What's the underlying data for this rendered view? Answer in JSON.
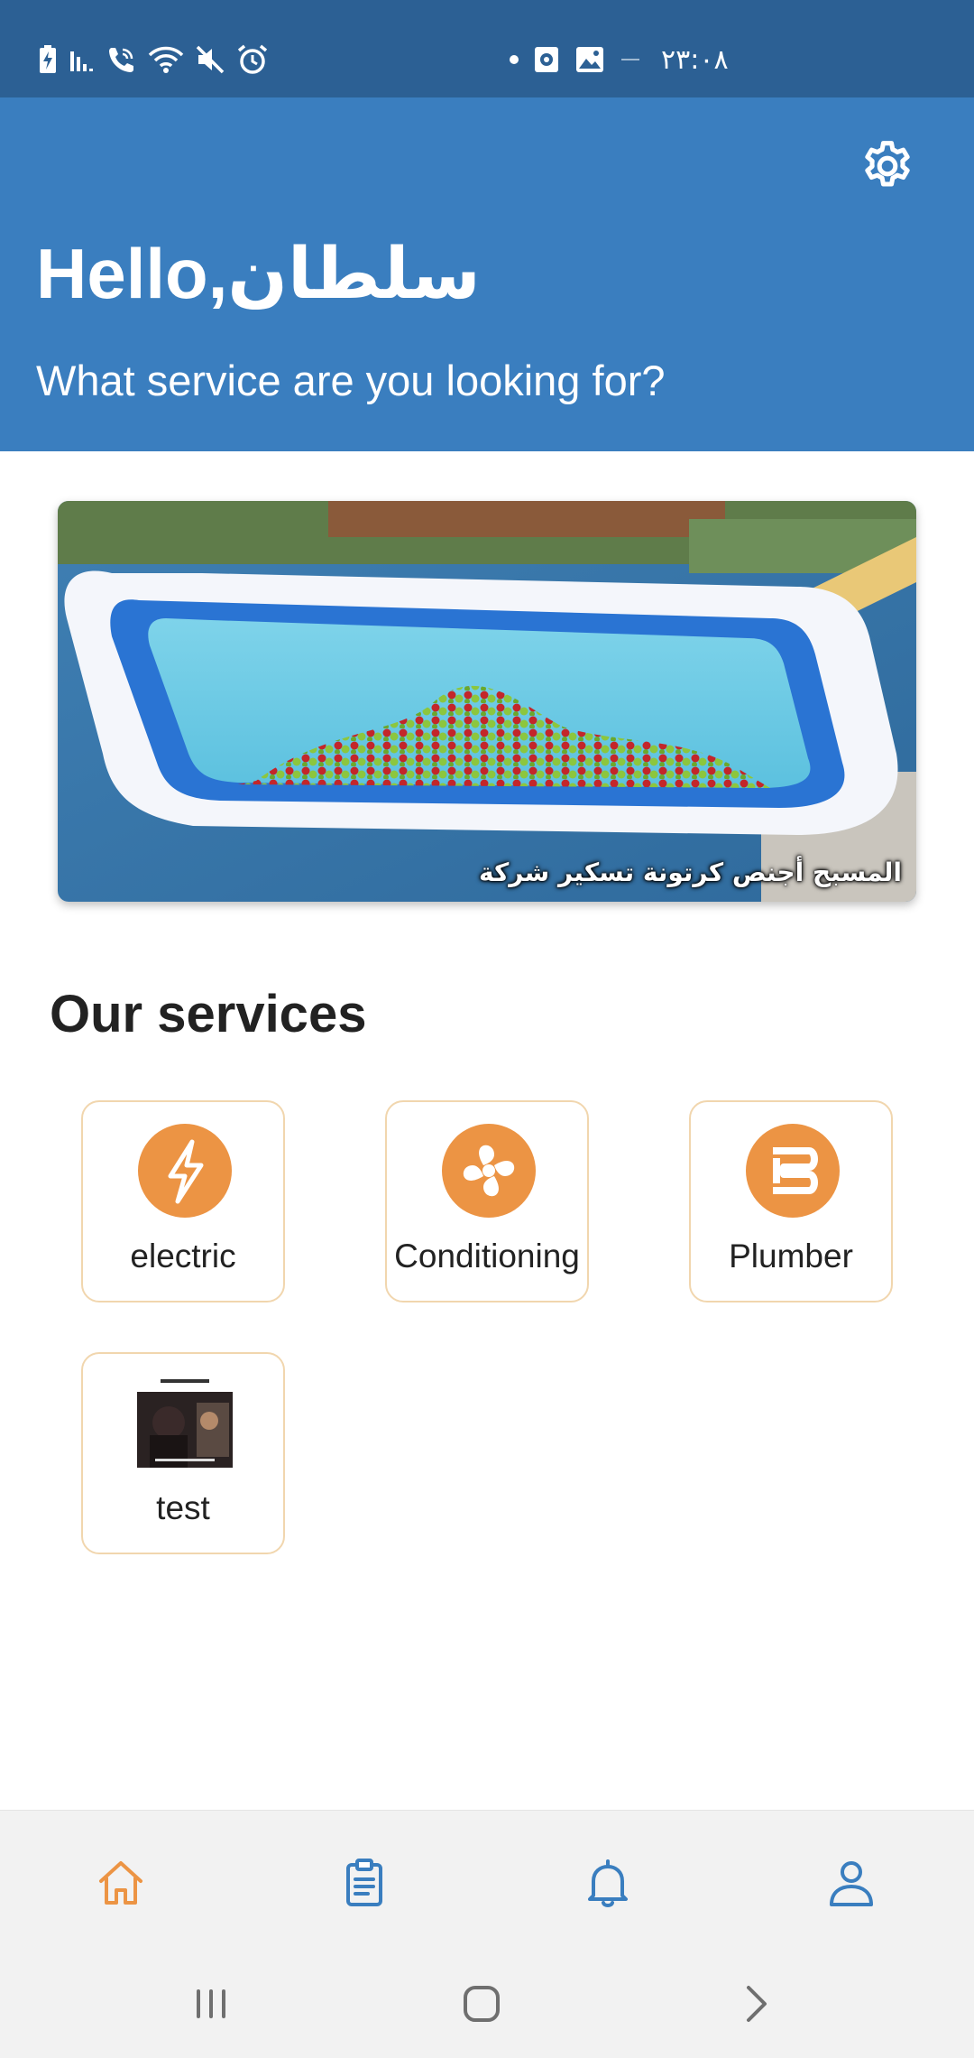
{
  "status_bar": {
    "time": "٢٣:٠٨",
    "icons": [
      "battery-charging-icon",
      "signal-icon",
      "wifi-call-icon",
      "wifi-icon",
      "mute-icon",
      "alarm-icon",
      "dot-icon",
      "screen-record-icon",
      "gallery-icon",
      "minus-icon"
    ]
  },
  "header": {
    "greeting_prefix": "Hello,",
    "user_name": "سلطان",
    "subtitle": "What service are you looking for?",
    "settings_icon": "gear-icon"
  },
  "banner": {
    "caption": "المسبح أجنص كرتونة تسكير شركة"
  },
  "services": {
    "title": "Our services",
    "items": [
      {
        "label": "electric",
        "icon": "lightning-icon"
      },
      {
        "label": "Conditioning",
        "icon": "fan-icon"
      },
      {
        "label": "Plumber",
        "icon": "pipe-icon"
      },
      {
        "label": "test",
        "icon": "thumbnail-image"
      }
    ]
  },
  "bottom_nav": {
    "items": [
      {
        "name": "home",
        "icon": "home-icon",
        "active": true
      },
      {
        "name": "orders",
        "icon": "clipboard-icon",
        "active": false
      },
      {
        "name": "notifications",
        "icon": "bell-icon",
        "active": false
      },
      {
        "name": "profile",
        "icon": "person-icon",
        "active": false
      }
    ]
  },
  "colors": {
    "status_bar": "#2c6094",
    "header": "#3a7ebf",
    "accent": "#ec9444",
    "card_border": "#f1d6ae",
    "nav_icon": "#3a7ebf"
  }
}
